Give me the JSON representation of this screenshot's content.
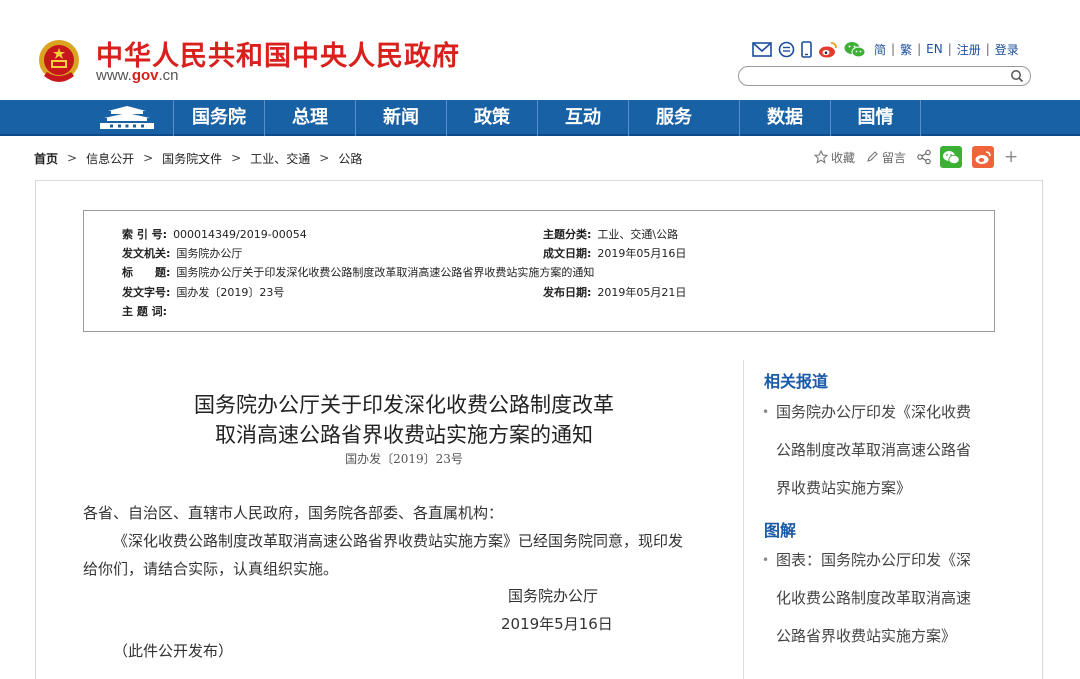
{
  "header": {
    "site_title": "中华人民共和国中央人民政府",
    "site_url_prefix": "www.",
    "site_url_gov": "gov",
    "site_url_suffix": ".cn",
    "lang_links": [
      "简",
      "繁",
      "EN",
      "注册",
      "登录"
    ],
    "search_placeholder": ""
  },
  "nav": {
    "items": [
      "国务院",
      "总理",
      "新闻",
      "政策",
      "互动",
      "服务",
      "数据",
      "国情"
    ]
  },
  "breadcrumb": {
    "items": [
      "首页",
      "信息公开",
      "国务院文件",
      "工业、交通",
      "公路"
    ],
    "arrow": ">"
  },
  "share": {
    "favorite_label": "收藏",
    "comment_label": "留言",
    "more_label": "+"
  },
  "meta": {
    "index_key": "索 引 号:",
    "index_val": "000014349/2019-00054",
    "category_key": "主题分类:",
    "category_val": "工业、交通\\公路",
    "issuer_key": "发文机关:",
    "issuer_val": "国务院办公厅",
    "written_key": "成文日期:",
    "written_val": "2019年05月16日",
    "title_key": "标　　题:",
    "title_val": "国务院办公厅关于印发深化收费公路制度改革取消高速公路省界收费站实施方案的通知",
    "docno_key": "发文字号:",
    "docno_val": "国办发〔2019〕23号",
    "published_key": "发布日期:",
    "published_val": "2019年05月21日",
    "keywords_key": "主 题 词:"
  },
  "document": {
    "title_line1": "国务院办公厅关于印发深化收费公路制度改革",
    "title_line2": "取消高速公路省界收费站实施方案的通知",
    "doc_no": "国办发〔2019〕23号",
    "salutation": "各省、自治区、直辖市人民政府，国务院各部委、各直属机构：",
    "para1_line1": "《深化收费公路制度改革取消高速公路省界收费站实施方案》已经国务院同意，现印发",
    "para1_line2": "给你们，请结合实际，认真组织实施。",
    "signer": "国务院办公厅",
    "date": "2019年5月16日",
    "note": "（此件公开发布）"
  },
  "sidebar": {
    "related_head": "相关报道",
    "related_item": [
      "国务院办公厅印发《深化收费",
      "公路制度改革取消高速公路省",
      "界收费站实施方案》"
    ],
    "chart_head": "图解",
    "chart_item": [
      "图表：国务院办公厅印发《深",
      "化收费公路制度改革取消高速",
      "公路省界收费站实施方案》"
    ],
    "bullet": "•"
  },
  "colors": {
    "brand_red": "#d8201c",
    "nav_blue": "#1961a5",
    "link_blue": "#1a5aa8",
    "wechat_green": "#3cb034",
    "weibo_orange": "#f0643c"
  }
}
